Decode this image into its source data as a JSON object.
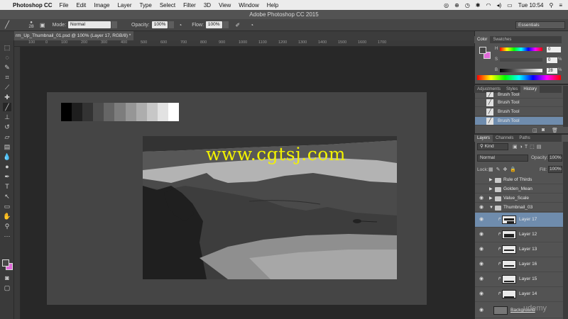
{
  "menubar": {
    "app": "Photoshop CC",
    "items": [
      "File",
      "Edit",
      "Image",
      "Layer",
      "Type",
      "Select",
      "Filter",
      "3D",
      "View",
      "Window",
      "Help"
    ],
    "clock": "Tue 10:54"
  },
  "window_title": "Adobe Photoshop CC 2015",
  "options": {
    "brush_size": "28",
    "mode_label": "Mode:",
    "mode_value": "Normal",
    "opacity_label": "Opacity:",
    "opacity_value": "100%",
    "flow_label": "Flow:",
    "flow_value": "100%",
    "workspace": "Essentials"
  },
  "document_tab": "rm_Up_Thumbnail_01.psd @ 100% (Layer 17, RGB/8) *",
  "ruler_ticks": [
    "100",
    "0",
    "100",
    "200",
    "300",
    "400",
    "500",
    "600",
    "700",
    "800",
    "900",
    "1000",
    "1100",
    "1200",
    "1300",
    "1400",
    "1500",
    "1600",
    "1700"
  ],
  "color_panel": {
    "tabs": [
      "Color",
      "Swatches"
    ],
    "h_label": "H",
    "h_value": "0",
    "s_label": "S",
    "s_value": "0",
    "b_label": "B",
    "b_value": "28",
    "b_unit": "%",
    "foreground": "#474747",
    "background": "#e06ad8"
  },
  "history_panel": {
    "tabs": [
      "Adjustments",
      "Styles",
      "History"
    ],
    "items": [
      "Brush Tool",
      "Brush Tool",
      "Brush Tool",
      "Brush Tool"
    ]
  },
  "layers_panel": {
    "tabs": [
      "Layers",
      "Channels",
      "Paths"
    ],
    "kind": "Kind",
    "blend_mode": "Normal",
    "opacity_label": "Opacity:",
    "opacity_value": "100%",
    "lock_label": "Lock:",
    "fill_label": "Fill:",
    "fill_value": "100%",
    "layers": [
      "Rule of Thirds",
      "Golden_Mean",
      "Value_Scale",
      "Thumbnail_03",
      "Layer 17",
      "Layer 12",
      "Layer 13",
      "Layer 16",
      "Layer 15",
      "Layer 14",
      "Background"
    ]
  },
  "watermark": "www.cgtsj.com",
  "udemy": "udemy",
  "value_scale": [
    "#000000",
    "#1e1e1e",
    "#333333",
    "#4c4c4c",
    "#656565",
    "#7d7d7d",
    "#969696",
    "#adadad",
    "#c7c7c7",
    "#e2e2e2",
    "#ffffff"
  ]
}
